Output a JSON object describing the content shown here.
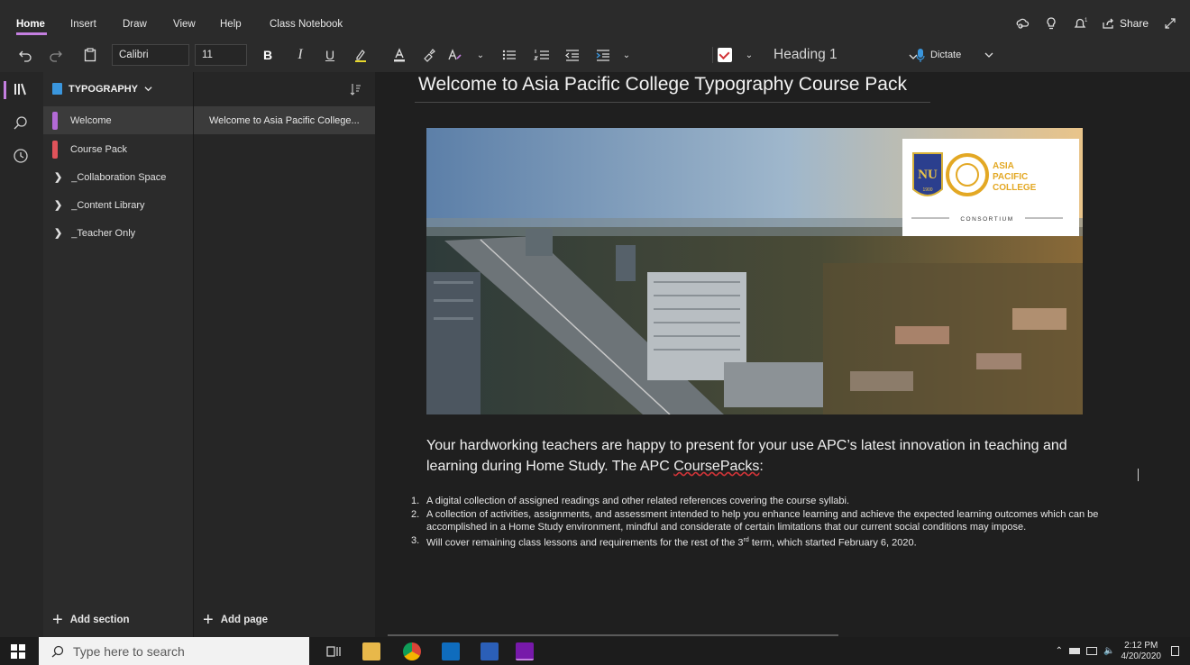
{
  "ribbon": {
    "tabs": [
      "Home",
      "Insert",
      "Draw",
      "View",
      "Help",
      "Class Notebook"
    ],
    "share_label": "Share"
  },
  "toolbar": {
    "font_name": "Calibri",
    "font_size": "11",
    "bold": "B",
    "italic": "I",
    "underline": "U",
    "style": "Heading 1",
    "dictate": "Dictate",
    "accent_color": "#c47fe0"
  },
  "notebook": {
    "name": "TYPOGRAPHY",
    "sections": [
      {
        "label": "Welcome",
        "color": "#b36ad6",
        "kind": "section",
        "selected": true
      },
      {
        "label": "Course Pack",
        "color": "#e0535a",
        "kind": "section",
        "selected": false
      },
      {
        "label": "_Collaboration Space",
        "kind": "group"
      },
      {
        "label": "_Content Library",
        "kind": "group"
      },
      {
        "label": "_Teacher Only",
        "kind": "group"
      }
    ],
    "add_section": "Add section",
    "add_page": "Add page"
  },
  "pages": [
    {
      "label": "Welcome to Asia Pacific College..."
    }
  ],
  "page": {
    "title": "Welcome to Asia Pacific College Typography Course Pack",
    "hero_logo": {
      "seal_letters": "NU",
      "seal_year": "1900",
      "brand_line1": "ASIA",
      "brand_line2": "PACIFIC",
      "brand_line3": "COLLEGE",
      "consortium": "CONSORTIUM"
    },
    "lead_part1": "Your hardworking teachers are happy to present for your use APC’s latest innovation in teaching and learning during Home Study.  The APC ",
    "lead_part2": "CoursePacks",
    "lead_part3": ":",
    "list": [
      {
        "num": "1.",
        "text": "A digital collection of assigned readings and other related references covering the course syllabi."
      },
      {
        "num": "2.",
        "text": "A collection of activities, assignments, and assessment intended to help you enhance learning and achieve the expected learning outcomes which can be accomplished in a Home Study environment, mindful and considerate of certain limitations that our current social conditions may impose."
      },
      {
        "num": "3.",
        "text_a": "Will cover remaining class lessons and requirements for the rest of the 3",
        "text_sup": "rd",
        "text_b": " term, which started February 6, 2020."
      }
    ]
  },
  "taskbar": {
    "search_placeholder": "Type here to search",
    "time": "2:12 PM",
    "date": "4/20/2020"
  }
}
